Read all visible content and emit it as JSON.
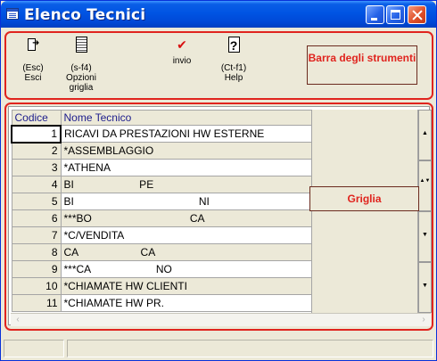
{
  "window": {
    "title": "Elenco Tecnici"
  },
  "toolbar": {
    "tools": [
      {
        "key": "(Esc)",
        "label": "Esci"
      },
      {
        "key": "(s-f4)",
        "label": "Opzioni",
        "label2": "griglia"
      },
      {
        "icon": "✔",
        "label": "invio"
      },
      {
        "key": "(Ct-f1)",
        "label": "Help"
      }
    ],
    "annotation": "Barra degli strumenti"
  },
  "grid": {
    "columns": [
      "Codice",
      "Nome Tecnico"
    ],
    "rows": [
      {
        "code": "1",
        "name": "RICAVI DA PRESTAZIONI HW ESTERNE"
      },
      {
        "code": "2",
        "name": "*ASSEMBLAGGIO"
      },
      {
        "code": "3",
        "name": "*ATHENA"
      },
      {
        "code": "4",
        "name": "BI                      PE"
      },
      {
        "code": "5",
        "name": "BI                                          NI"
      },
      {
        "code": "6",
        "name": "***BO                                 CA"
      },
      {
        "code": "7",
        "name": "*C/VENDITA"
      },
      {
        "code": "8",
        "name": "CA                     CA"
      },
      {
        "code": "9",
        "name": "***CA                      NO"
      },
      {
        "code": "10",
        "name": "*CHIAMATE HW CLIENTI"
      },
      {
        "code": "11",
        "name": "*CHIAMATE HW PR."
      }
    ],
    "annotation": "Griglia",
    "scroll_arrows": [
      "▲",
      "▲▼",
      "▼",
      "▼"
    ]
  },
  "icons": [
    "exit-door-icon",
    "grid-options-icon",
    "checkmark-icon",
    "help-icon"
  ],
  "colors": {
    "accent_red": "#e0241e",
    "titlebar_blue": "#0054e3",
    "header_text": "#1c1c8c"
  }
}
